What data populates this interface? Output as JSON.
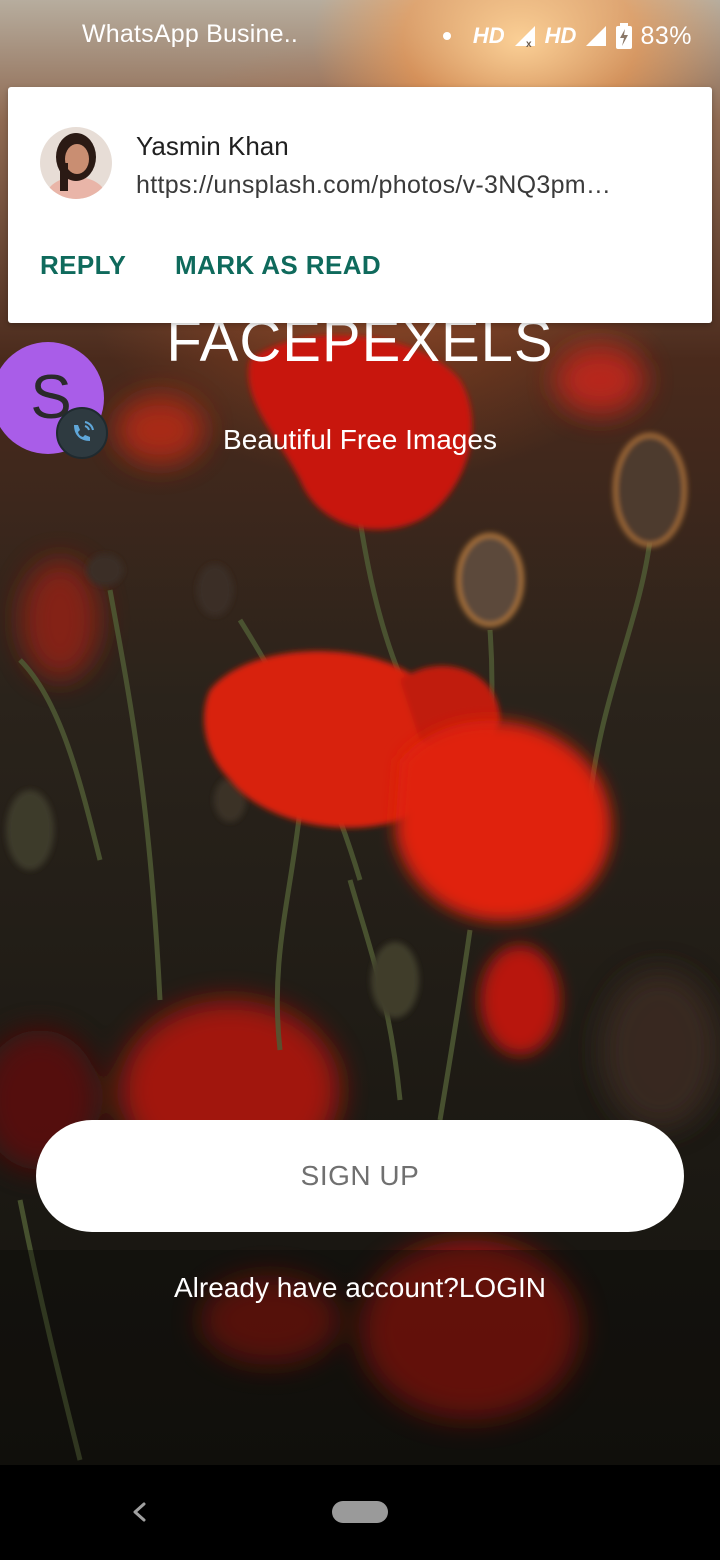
{
  "status_bar": {
    "left_text": "WhatsApp Busine..",
    "network_1": "HD",
    "network_2": "HD",
    "battery": "83%"
  },
  "notification": {
    "sender": "Yasmin Khan",
    "message": "https://unsplash.com/photos/v-3NQ3pm…",
    "actions": [
      "REPLY",
      "MARK AS READ"
    ],
    "action_color": "#0f6a5c"
  },
  "app": {
    "title": "FACEPEXELS",
    "subtitle": "Beautiful Free Images",
    "signup_label": "SIGN UP",
    "login_prompt": "Already have account?",
    "login_link": "LOGIN"
  },
  "chat_head": {
    "letter": "S",
    "color": "#a95de8",
    "badge_icon": "phone-call-icon"
  },
  "nav_bar": {
    "back_icon": "back-chevron-icon",
    "home_icon": "home-pill-icon"
  }
}
